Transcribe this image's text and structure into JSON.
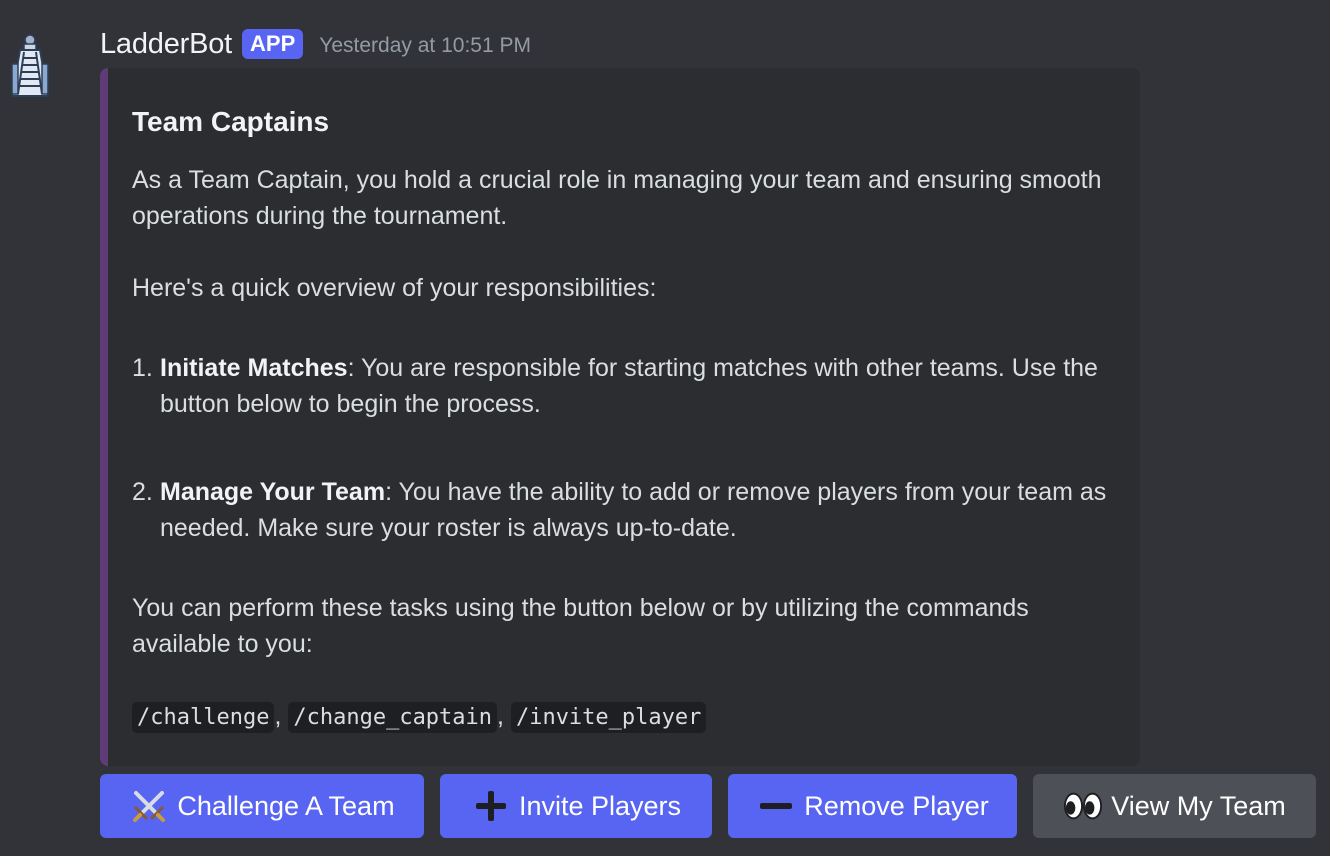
{
  "message": {
    "username": "LadderBot",
    "badge": "APP",
    "timestamp": "Yesterday at 10:51 PM",
    "avatar_icon": "ladder-tower-icon"
  },
  "embed": {
    "accent_color": "#5f3b78",
    "title": "Team Captains",
    "intro": "As a Team Captain, you hold a crucial role in managing your team and ensuring smooth operations during the tournament.",
    "overview": "Here's a quick overview of your responsibilities:",
    "items": [
      {
        "number": "1.",
        "heading": "Initiate Matches",
        "text": ": You are responsible for starting matches with other teams. Use the button below to begin the process."
      },
      {
        "number": "2.",
        "heading": "Manage Your Team",
        "text": ": You have the ability to add or remove players from your team as needed. Make sure your roster is always up-to-date."
      }
    ],
    "tasks": "You can perform these tasks using the button below or by utilizing the commands available to you:",
    "commands": [
      "/challenge",
      "/change_captain",
      "/invite_player"
    ],
    "command_separator": ","
  },
  "buttons": [
    {
      "label": "Challenge A Team",
      "icon": "crossed-swords-icon",
      "style": "primary"
    },
    {
      "label": "Invite Players",
      "icon": "plus-icon",
      "style": "primary"
    },
    {
      "label": "Remove Player",
      "icon": "minus-icon",
      "style": "primary"
    },
    {
      "label": "View My Team",
      "icon": "eyes-icon",
      "style": "secondary"
    }
  ],
  "colors": {
    "background": "#313338",
    "embed_background": "#2b2d31",
    "blurple": "#5865f2",
    "secondary_button": "#4e5058"
  }
}
